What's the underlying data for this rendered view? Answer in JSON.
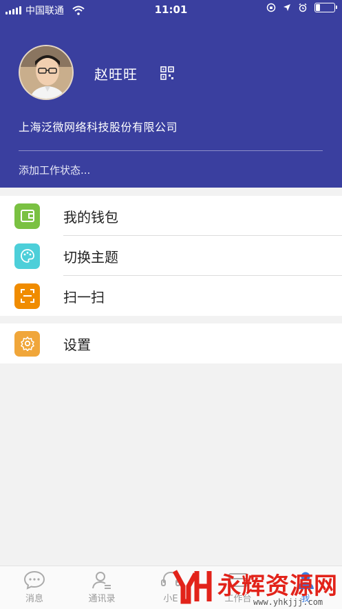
{
  "status_bar": {
    "carrier": "中国联通",
    "time": "11:01",
    "battery_level": 0.25
  },
  "profile": {
    "name": "赵旺旺",
    "qr_icon": "qr-code-icon",
    "company": "上海泛微网络科技股份有限公司",
    "work_status_placeholder": "添加工作状态..."
  },
  "menu_groups": [
    {
      "items": [
        {
          "label": "我的钱包",
          "icon": "wallet-icon",
          "color": "#7ac142"
        },
        {
          "label": "切换主题",
          "icon": "palette-icon",
          "color": "#4dcfd9"
        },
        {
          "label": "扫一扫",
          "icon": "scan-icon",
          "color": "#f08c00"
        }
      ]
    },
    {
      "items": [
        {
          "label": "设置",
          "icon": "gear-icon",
          "color": "#f0a63a"
        }
      ]
    }
  ],
  "tabbar": {
    "tabs": [
      {
        "label": "消息",
        "icon": "chat-icon"
      },
      {
        "label": "通讯录",
        "icon": "contacts-icon"
      },
      {
        "label": "小E",
        "icon": "assistant-icon"
      },
      {
        "label": "工作台",
        "icon": "workbench-icon"
      },
      {
        "label": "我",
        "icon": "me-icon",
        "active": true
      }
    ]
  },
  "colors": {
    "header_bg": "#3a3f9f",
    "page_bg": "#f2f2f2"
  },
  "watermark": {
    "text": "永辉资源网",
    "url": "www.yhkjjj.com"
  }
}
